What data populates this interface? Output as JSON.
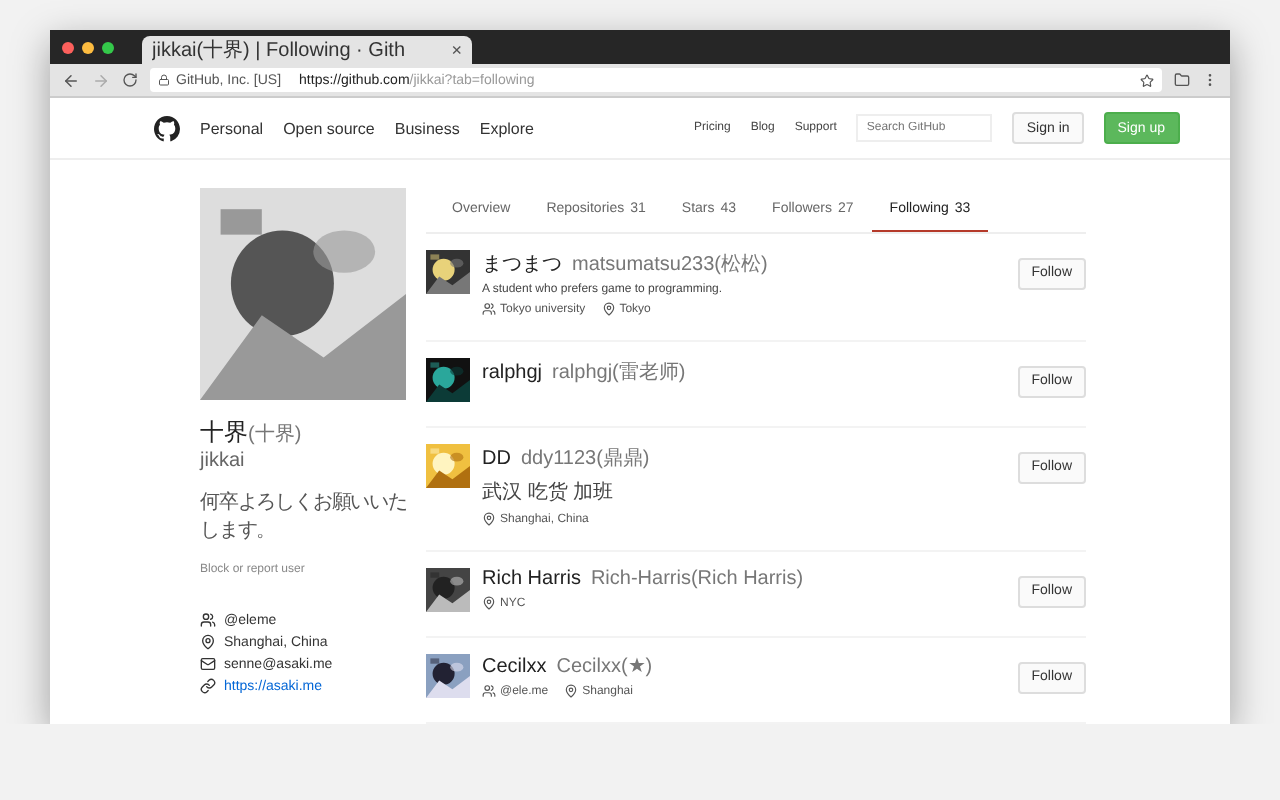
{
  "browser": {
    "tab_title": "jikkai(十界) | Following · Gith",
    "tab_close": "×",
    "site_identity": "GitHub, Inc. [US]",
    "url_host": "https://github.com",
    "url_path": "/jikkai?tab=following"
  },
  "header": {
    "nav": [
      "Personal",
      "Open source",
      "Business",
      "Explore"
    ],
    "links": [
      "Pricing",
      "Blog",
      "Support"
    ],
    "search": {
      "placeholder": "Search GitHub"
    },
    "sign_in": "Sign in",
    "sign_up": "Sign up"
  },
  "profile": {
    "name": "十界",
    "name_note": "(十界)",
    "login": "jikkai",
    "bio": "何卒よろしくお願いいたします。",
    "block": "Block or report user",
    "details": [
      {
        "kind": "org",
        "text": "@eleme"
      },
      {
        "kind": "location",
        "text": "Shanghai, China"
      },
      {
        "kind": "email",
        "text": "senne@asaki.me"
      },
      {
        "kind": "link",
        "text": "https://asaki.me"
      }
    ]
  },
  "tabs": [
    {
      "label": "Overview",
      "selected": false
    },
    {
      "label": "Repositories",
      "count": "31",
      "selected": false
    },
    {
      "label": "Stars",
      "count": "43",
      "selected": false
    },
    {
      "label": "Followers",
      "count": "27",
      "selected": false
    },
    {
      "label": "Following",
      "count": "33",
      "selected": true
    }
  ],
  "users": [
    {
      "name": "まつまつ",
      "login": "matsumatsu233(松松)",
      "bio": "A student who prefers game to programming.",
      "org": "Tokyo university",
      "location": "Tokyo",
      "button": "Follow"
    },
    {
      "name": "ralphgj",
      "login": "ralphgj(雷老师)",
      "button": "Follow"
    },
    {
      "name": "DD",
      "login": "ddy1123(鼎鼎)",
      "bio": "武汉 吃货 加班",
      "location": "Shanghai, China",
      "button": "Follow"
    },
    {
      "name": "Rich Harris",
      "login": "Rich-Harris(Rich Harris)",
      "location": "NYC",
      "button": "Follow"
    },
    {
      "name": "Cecilxx",
      "login": "Cecilxx(★)",
      "org": "@ele.me",
      "location": "Shanghai",
      "button": "Follow"
    }
  ]
}
